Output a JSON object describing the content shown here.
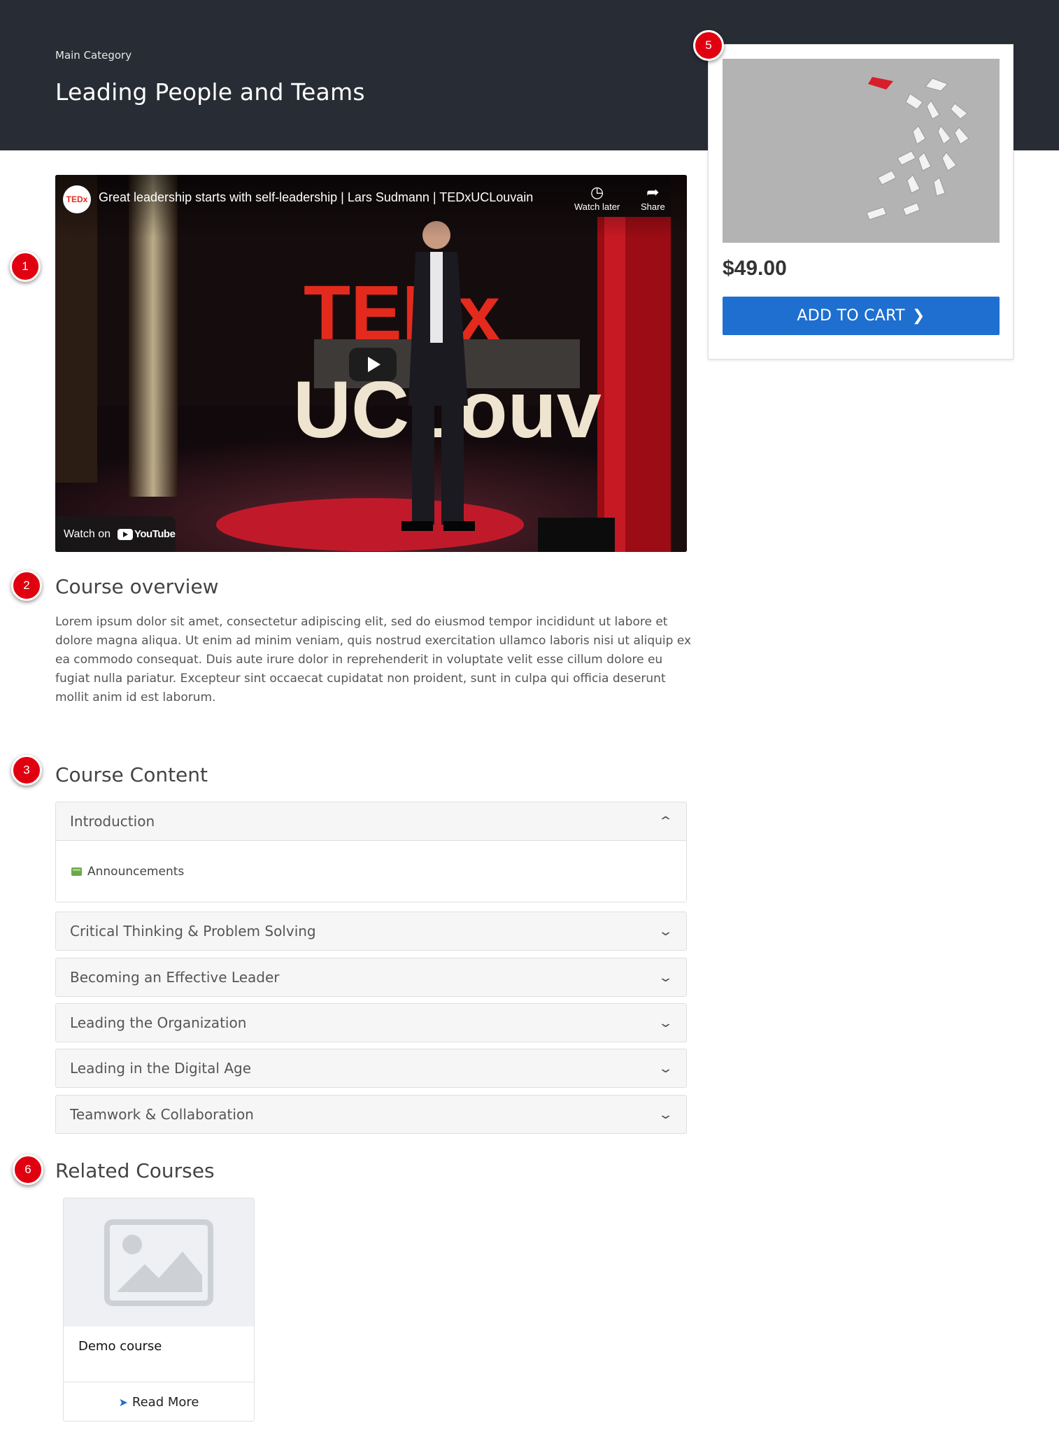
{
  "hero": {
    "category": "Main Category",
    "title": "Leading People and Teams"
  },
  "markers": [
    "1",
    "2",
    "3",
    "5",
    "6"
  ],
  "video": {
    "channel_badge": "TEDx",
    "title": "Great leadership starts with self-leadership | Lars Sudmann | TEDxUCLouvain",
    "watch_later": "Watch later",
    "share": "Share",
    "watch_on": "Watch on",
    "youtube": "YouTube",
    "stage_letters_top": "TEDx",
    "stage_letters_bottom": "UCLouv"
  },
  "product": {
    "price": "$49.00",
    "add_to_cart": "ADD TO CART",
    "chevron_icon": "chevron-right-icon"
  },
  "overview": {
    "heading": "Course overview",
    "text": "Lorem ipsum dolor sit amet, consectetur adipiscing elit, sed do eiusmod tempor incididunt ut labore et dolore magna aliqua. Ut enim ad minim veniam, quis nostrud exercitation ullamco laboris nisi ut aliquip ex ea commodo consequat. Duis aute irure dolor in reprehenderit in voluptate velit esse cillum dolore eu fugiat nulla pariatur. Excepteur sint occaecat cupidatat non proident, sunt in culpa qui officia deserunt mollit anim id est laborum."
  },
  "content": {
    "heading": "Course Content",
    "sections": [
      {
        "title": "Introduction",
        "expanded": true,
        "items": [
          "Announcements"
        ]
      },
      {
        "title": "Critical Thinking & Problem Solving",
        "expanded": false
      },
      {
        "title": "Becoming an Effective Leader",
        "expanded": false
      },
      {
        "title": "Leading the Organization",
        "expanded": false
      },
      {
        "title": "Leading in the Digital Age",
        "expanded": false
      },
      {
        "title": "Teamwork & Collaboration",
        "expanded": false
      }
    ]
  },
  "related": {
    "heading": "Related Courses",
    "courses": [
      {
        "name": "Demo course",
        "read_more": "Read More"
      }
    ]
  },
  "colors": {
    "header_bg": "#282c34",
    "accent": "#1e6fcf",
    "marker": "#e00010"
  }
}
